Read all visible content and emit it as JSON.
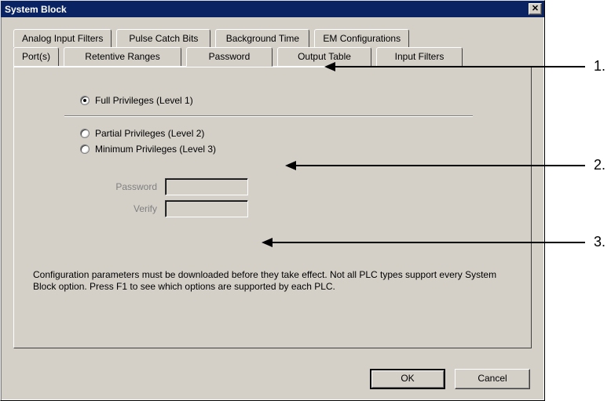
{
  "title": "System Block",
  "tabs_row1": [
    {
      "label": "Analog Input Filters"
    },
    {
      "label": "Pulse Catch Bits"
    },
    {
      "label": "Background Time"
    },
    {
      "label": "EM Configurations"
    }
  ],
  "tabs_row2": [
    {
      "label": "Port(s)"
    },
    {
      "label": "Retentive Ranges"
    },
    {
      "label": "Password"
    },
    {
      "label": "Output Table"
    },
    {
      "label": "Input Filters"
    }
  ],
  "radios": {
    "full": "Full Privileges (Level 1)",
    "partial": "Partial Privileges (Level 2)",
    "minimum": "Minimum Privileges (Level 3)"
  },
  "fields": {
    "password_label": "Password",
    "verify_label": "Verify",
    "password_value": "",
    "verify_value": ""
  },
  "footer": "Configuration parameters must be downloaded before they take effect.  Not all PLC types support every System Block option.  Press F1 to see which options are supported by each PLC.",
  "buttons": {
    "ok": "OK",
    "cancel": "Cancel"
  },
  "annotations": [
    "1.",
    "2.",
    "3."
  ]
}
